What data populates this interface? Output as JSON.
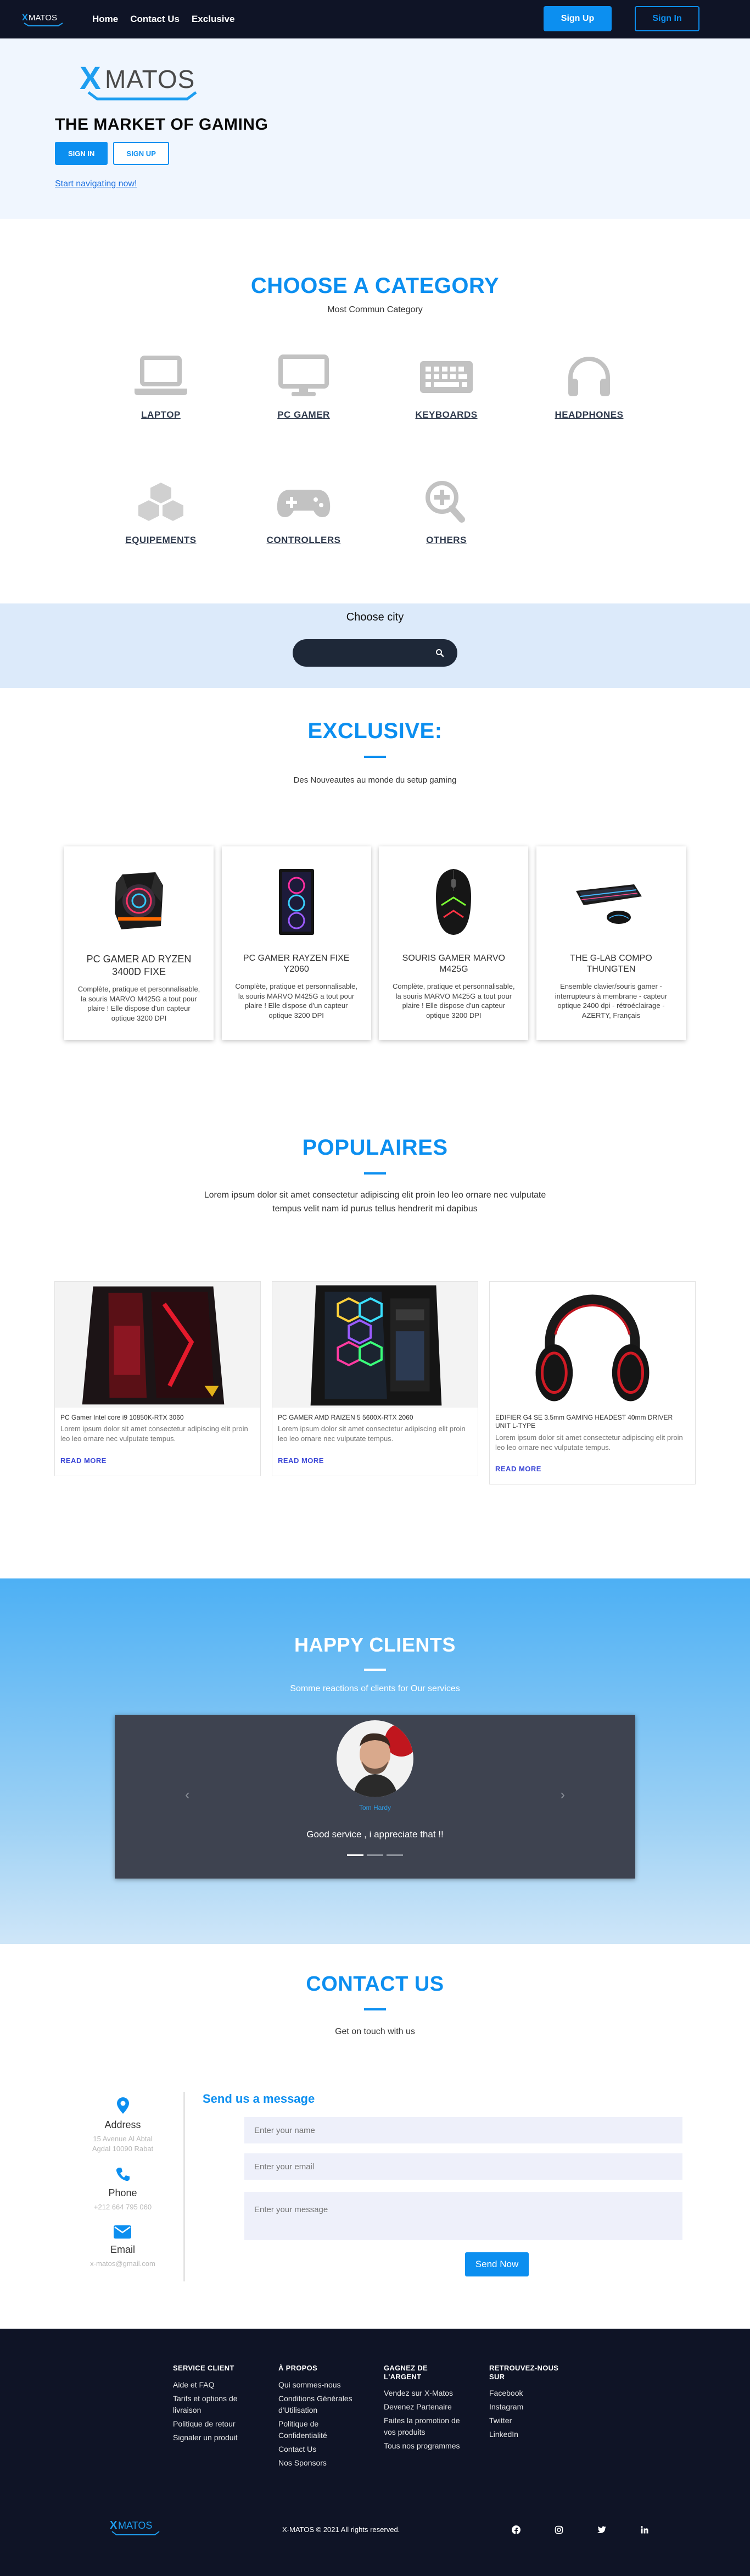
{
  "brand": {
    "name": "X-MATOS",
    "logo_text": "XMATOS",
    "accent": "#0c8ff0",
    "dark": "#0f1426"
  },
  "nav": {
    "links": [
      "Home",
      "Contact Us",
      "Exclusive"
    ],
    "signup_label": "Sign Up",
    "signin_label": "Sign In"
  },
  "hero": {
    "title": "THE MARKET OF GAMING",
    "signin_label": "SIGN IN",
    "signup_label": "SIGN UP",
    "link_text": "Start navigating now!"
  },
  "categories": {
    "title": "CHOOSE A CATEGORY",
    "subtitle": "Most Commun Category",
    "items": [
      {
        "label": "LAPTOP",
        "icon": "laptop-icon"
      },
      {
        "label": "PC GAMER",
        "icon": "desktop-icon"
      },
      {
        "label": "KEYBOARDS",
        "icon": "keyboard-icon"
      },
      {
        "label": "HEADPHONES",
        "icon": "headphones-icon"
      },
      {
        "label": "EQUIPEMENTS",
        "icon": "cubes-icon"
      },
      {
        "label": "CONTROLLERS",
        "icon": "gamepad-icon"
      },
      {
        "label": "OTHERS",
        "icon": "search-plus-icon"
      }
    ]
  },
  "city": {
    "label": "Choose city",
    "search_value": ""
  },
  "exclusive": {
    "title": "EXCLUSIVE:",
    "subtitle": "Des Nouveautes au monde du setup gaming",
    "cards": [
      {
        "name": "PC GAMER AD RYZEN 3400D FIXE",
        "desc": "Complète, pratique et personnalisable, la souris MARVO M425G a tout pour plaire ! Elle dispose d'un capteur optique 3200 DPI"
      },
      {
        "name": "PC GAMER RAYZEN FIXE Y2060",
        "desc": "Complète, pratique et personnalisable, la souris MARVO M425G a tout pour plaire ! Elle dispose d'un capteur optique 3200 DPI"
      },
      {
        "name": "SOURIS GAMER MARVO M425G",
        "desc": "Complète, pratique et personnalisable, la souris MARVO M425G a tout pour plaire ! Elle dispose d'un capteur optique 3200 DPI"
      },
      {
        "name": "THE G-LAB COMPO THUNGTEN",
        "desc": "Ensemble clavier/souris gamer - interrupteurs à membrane - capteur optique 2400 dpi - rétroéclairage - AZERTY, Français"
      }
    ]
  },
  "popular": {
    "title": "POPULAIRES",
    "text": "Lorem ipsum dolor sit amet consectetur adipiscing elit proin leo leo ornare nec vulputate tempus velit nam id purus tellus hendrerit mi dapibus",
    "read_more": "READ MORE",
    "cards": [
      {
        "title": "PC Gamer Intel core i9 10850K-RTX 3060",
        "text": "Lorem ipsum dolor sit amet consectetur adipiscing elit proin leo leo ornare nec vulputate tempus."
      },
      {
        "title": "PC GAMER AMD RAIZEN 5 5600X-RTX 2060",
        "text": "Lorem ipsum dolor sit amet consectetur adipiscing elit proin leo leo ornare nec vulputate tempus."
      },
      {
        "title": "EDIFIER G4 SE 3.5mm GAMING HEADEST 40mm DRIVER UNIT L-TYPE",
        "text": "Lorem ipsum dolor sit amet consectetur adipiscing elit proin leo leo ornare nec vulputate tempus."
      }
    ]
  },
  "clients": {
    "title": "HAPPY CLIENTS",
    "subtitle": "Somme reactions of clients for Our services",
    "name": "Tom Hardy",
    "quote": "Good service , i appreciate that !!",
    "prev": "‹",
    "next": "›",
    "active_slide": 1,
    "slide_count": 3
  },
  "contact": {
    "title": "CONTACT US",
    "subtitle": "Get on touch with us",
    "address_title": "Address",
    "address_value": "15 Avenue Al Abtal Agdal 10090 Rabat",
    "phone_title": "Phone",
    "phone_value": "+212 664 795 060",
    "email_title": "Email",
    "email_value": "x-matos@gmail.com",
    "form_title": "Send us a message",
    "name_placeholder": "Enter your name",
    "email_placeholder": "Enter your email",
    "message_placeholder": "Enter your message",
    "send_label": "Send Now"
  },
  "footer": {
    "columns": [
      {
        "title": "SERVICE CLIENT",
        "items": [
          "Aide et FAQ",
          "Tarifs et options de livraison",
          "Politique de retour",
          "Signaler un produit"
        ]
      },
      {
        "title": "À PROPOS",
        "items": [
          "Qui sommes-nous",
          "Conditions Générales d'Utilisation",
          "Politique de Confidentialité",
          "Contact Us",
          "Nos Sponsors"
        ]
      },
      {
        "title": "GAGNEZ DE L'ARGENT",
        "items": [
          "Vendez sur X-Matos",
          "Devenez Partenaire",
          "Faites la promotion de vos produits",
          "Tous nos programmes"
        ]
      },
      {
        "title": "RETROUVEZ-NOUS SUR",
        "items": [
          "Facebook",
          "Instagram",
          "Twitter",
          "LinkedIn"
        ]
      }
    ],
    "copyright": "X-MATOS © 2021 All rights reserved.",
    "social_icons": [
      "facebook-icon",
      "instagram-icon",
      "twitter-icon",
      "linkedin-icon"
    ]
  }
}
